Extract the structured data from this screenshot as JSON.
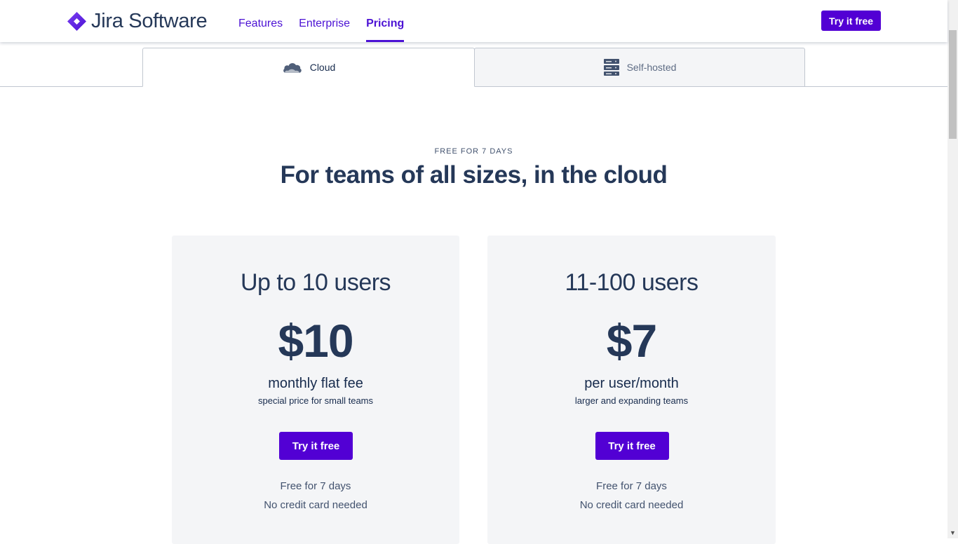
{
  "header": {
    "logo_text": "Jira Software",
    "nav": [
      {
        "label": "Features"
      },
      {
        "label": "Enterprise"
      },
      {
        "label": "Pricing",
        "active": true
      }
    ],
    "cta_label": "Try it free"
  },
  "tabs": {
    "cloud": {
      "label": "Cloud",
      "icon": "cloud-icon",
      "selected": true
    },
    "self_hosted": {
      "label": "Self-hosted",
      "icon": "server-icon"
    }
  },
  "hero": {
    "eyebrow": "FREE FOR 7 DAYS",
    "title": "For teams of all sizes, in the cloud"
  },
  "plans": [
    {
      "title": "Up to 10 users",
      "price": "$10",
      "unit": "monthly flat fee",
      "subtitle": "special price for small teams",
      "cta": "Try it free",
      "note1": "Free for 7 days",
      "note2": "No credit card needed"
    },
    {
      "title": "11-100 users",
      "price": "$7",
      "unit": "per user/month",
      "subtitle": "larger and expanding teams",
      "cta": "Try it free",
      "note1": "Free for 7 days",
      "note2": "No credit card needed"
    }
  ],
  "colors": {
    "brand": "#5200d4",
    "nav_link": "#4c12d4",
    "heading": "#253858",
    "card_bg": "#f4f5f7"
  }
}
